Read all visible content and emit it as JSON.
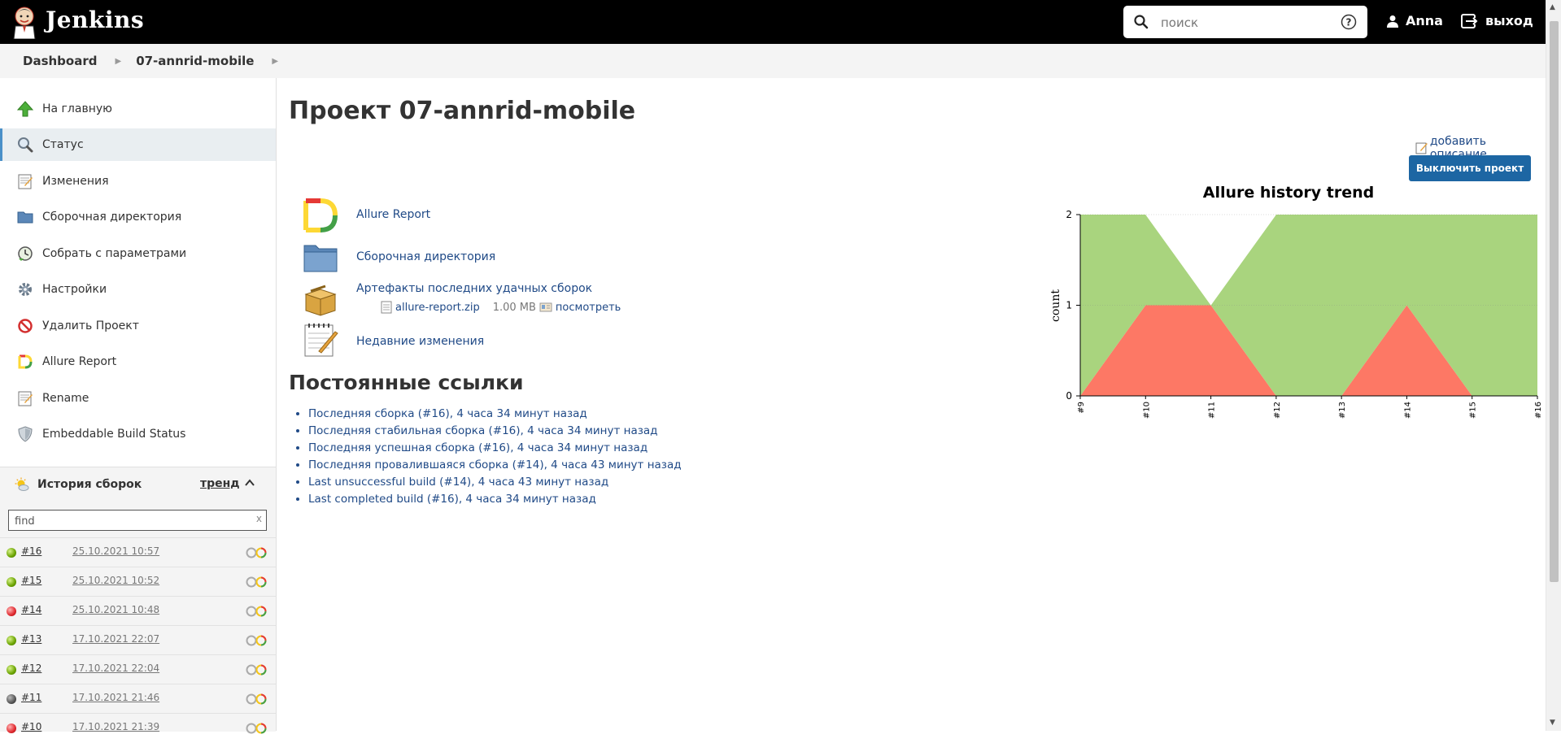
{
  "header": {
    "brand": "Jenkins",
    "search_placeholder": "поиск",
    "user_name": "Anna",
    "logout_label": "выход"
  },
  "breadcrumb": [
    "Dashboard",
    "07-annrid-mobile"
  ],
  "sidebar": {
    "items": [
      {
        "label": "На главную",
        "icon": "up-arrow-icon"
      },
      {
        "label": "Статус",
        "icon": "magnifier-icon"
      },
      {
        "label": "Изменения",
        "icon": "notepad-icon"
      },
      {
        "label": "Сборочная директория",
        "icon": "folder-icon"
      },
      {
        "label": "Собрать с параметрами",
        "icon": "clock-build-icon"
      },
      {
        "label": "Настройки",
        "icon": "gear-icon"
      },
      {
        "label": "Удалить Проект",
        "icon": "no-entry-icon"
      },
      {
        "label": "Allure Report",
        "icon": "allure-icon"
      },
      {
        "label": "Rename",
        "icon": "notepad-icon"
      },
      {
        "label": "Embeddable Build Status",
        "icon": "shield-icon"
      }
    ]
  },
  "history": {
    "title": "История сборок",
    "trend_label": "тренд",
    "find_placeholder": "find",
    "clear_label": "x",
    "builds": [
      {
        "num": "#16",
        "date": "25.10.2021 10:57",
        "status": "green"
      },
      {
        "num": "#15",
        "date": "25.10.2021 10:52",
        "status": "green"
      },
      {
        "num": "#14",
        "date": "25.10.2021 10:48",
        "status": "red"
      },
      {
        "num": "#13",
        "date": "17.10.2021 22:07",
        "status": "green"
      },
      {
        "num": "#12",
        "date": "17.10.2021 22:04",
        "status": "green"
      },
      {
        "num": "#11",
        "date": "17.10.2021 21:46",
        "status": "grey"
      },
      {
        "num": "#10",
        "date": "17.10.2021 21:39",
        "status": "red"
      }
    ]
  },
  "main": {
    "title": "Проект 07-annrid-mobile",
    "add_description": "добавить описание",
    "disable_button": "Выключить проект",
    "tasks": [
      {
        "label": "Allure Report",
        "icon": "allure-icon"
      },
      {
        "label": "Сборочная директория",
        "icon": "folder-icon"
      },
      {
        "label": "Артефакты последних удачных сборок",
        "icon": "package-icon"
      },
      {
        "label": "Недавние изменения",
        "icon": "notepad-icon"
      }
    ],
    "artifact": {
      "file": "allure-report.zip",
      "size": "1.00 MB",
      "view_label": "посмотреть"
    },
    "permalinks_title": "Постоянные ссылки",
    "permalinks": [
      "Последняя сборка (#16), 4 часа 34 минут назад",
      "Последняя стабильная сборка (#16), 4 часа 34 минут назад",
      "Последняя успешная сборка (#16), 4 часа 34 минут назад",
      "Последняя провалившаяся сборка (#14), 4 часа 43 минут назад",
      "Last unsuccessful build (#14), 4 часа 43 минут назад",
      "Last completed build (#16), 4 часа 34 минут назад"
    ]
  },
  "chart_data": {
    "type": "area",
    "title": "Allure history trend",
    "xlabel": "",
    "ylabel": "count",
    "x": [
      "#9",
      "#10",
      "#11",
      "#12",
      "#13",
      "#14",
      "#15",
      "#16"
    ],
    "ylim": [
      0,
      2
    ],
    "yticks": [
      "0",
      "1",
      "2"
    ],
    "series": [
      {
        "values": [
          0,
          1,
          1,
          0,
          0,
          1,
          0,
          0
        ],
        "color": "#fd7865"
      },
      {
        "values": [
          2,
          1,
          0,
          2,
          2,
          1,
          2,
          2
        ],
        "color": "#a9d47e"
      },
      {
        "values": [
          0,
          0,
          1,
          0,
          0,
          0,
          0,
          0
        ],
        "color": "#ffffff"
      }
    ],
    "grid": true
  }
}
